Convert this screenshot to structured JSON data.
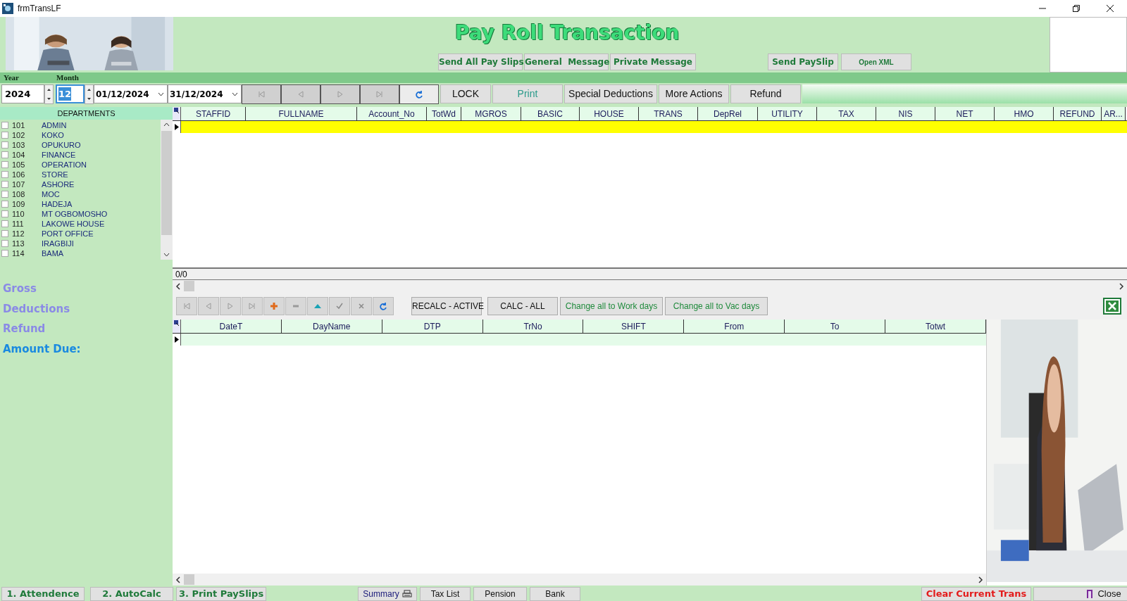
{
  "window": {
    "title": "frmTransLF"
  },
  "header": {
    "title": "Pay Roll Transaction",
    "buttons": [
      {
        "label": "Send All Pay Slips",
        "kind": "bold"
      },
      {
        "label": "General  Message",
        "kind": "bold"
      },
      {
        "label": "Private Message",
        "kind": "bold"
      },
      {
        "label": "Send PaySlip",
        "kind": "bold"
      },
      {
        "label": "Open XML",
        "kind": "small"
      }
    ]
  },
  "period": {
    "year_label": "Year",
    "month_label": "Month",
    "year": "2024",
    "month": "12",
    "date_from": "01/12/2024",
    "date_to": "31/12/2024"
  },
  "toolbar": [
    {
      "label": "LOCK",
      "kind": "plain"
    },
    {
      "label": "Print",
      "kind": "teal"
    },
    {
      "label": "Special Deductions",
      "kind": "plain"
    },
    {
      "label": "More Actions",
      "kind": "plain"
    },
    {
      "label": "Refund",
      "kind": "plain"
    }
  ],
  "departments": {
    "title": "DEPARTMENTS",
    "items": [
      {
        "code": "101",
        "name": "ADMIN",
        "checked": false
      },
      {
        "code": "102",
        "name": "KOKO",
        "checked": false
      },
      {
        "code": "103",
        "name": "OPUKURO",
        "checked": false
      },
      {
        "code": "104",
        "name": "FINANCE",
        "checked": false
      },
      {
        "code": "105",
        "name": "OPERATION",
        "checked": false
      },
      {
        "code": "106",
        "name": "STORE",
        "checked": false
      },
      {
        "code": "107",
        "name": "ASHORE",
        "checked": false
      },
      {
        "code": "108",
        "name": "MOC",
        "checked": false
      },
      {
        "code": "109",
        "name": "HADEJA",
        "checked": false
      },
      {
        "code": "110",
        "name": "MT OGBOMOSHO",
        "checked": false
      },
      {
        "code": "111",
        "name": "LAKOWE HOUSE",
        "checked": false
      },
      {
        "code": "112",
        "name": "PORT OFFICE",
        "checked": false
      },
      {
        "code": "113",
        "name": "IRAGBIJI",
        "checked": false
      },
      {
        "code": "114",
        "name": "BAMA",
        "checked": false
      }
    ]
  },
  "totals": [
    {
      "label": "Gross",
      "kind": "muted"
    },
    {
      "label": "Deductions",
      "kind": "muted"
    },
    {
      "label": "Refund",
      "kind": "muted"
    },
    {
      "label": "Amount Due:",
      "kind": "strong"
    }
  ],
  "pay_grid": {
    "columns": [
      "STAFFID",
      "FULLNAME",
      "Account_No",
      "TotWd",
      "MGROS",
      "BASIC",
      "HOUSE",
      "TRANS",
      "DepRel",
      "UTILITY",
      "TAX",
      "NIS",
      "NET",
      "HMO",
      "REFUND",
      "AR..."
    ],
    "record_count": "0/0"
  },
  "detail_toolbar": [
    {
      "label": "RECALC - ACTIVE",
      "kind": "plain"
    },
    {
      "label": "CALC - ALL",
      "kind": "plain"
    },
    {
      "label": "Change all to Work days",
      "kind": "green"
    },
    {
      "label": "Change all to Vac days",
      "kind": "green"
    }
  ],
  "attendance_grid": {
    "columns": [
      "DateT",
      "DayName",
      "DTP",
      "TrNo",
      "SHIFT",
      "From",
      "To",
      "Totwt"
    ]
  },
  "footer": [
    {
      "label": "1. Attendence",
      "kind": "step"
    },
    {
      "label": "2. AutoCalc",
      "kind": "step"
    },
    {
      "label": "3. Print PaySlips",
      "kind": "step"
    },
    {
      "label": "Summary",
      "kind": "report"
    },
    {
      "label": "Tax List",
      "kind": "plain"
    },
    {
      "label": "Pension",
      "kind": "plain"
    },
    {
      "label": "Bank",
      "kind": "plain"
    },
    {
      "label": "Clear Current Trans",
      "kind": "danger"
    },
    {
      "label": "Close",
      "kind": "close"
    }
  ]
}
